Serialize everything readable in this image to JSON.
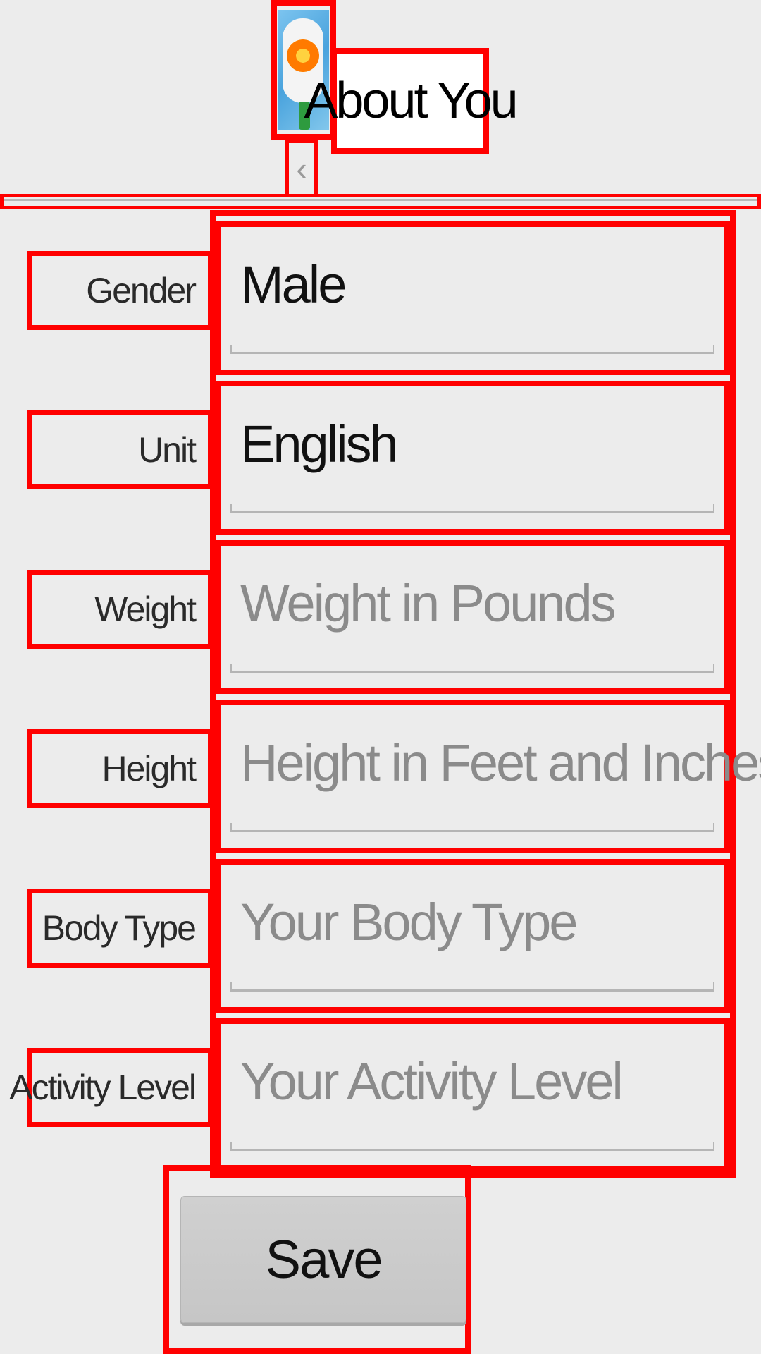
{
  "header": {
    "title": "About You",
    "app_icon": "app-logo-icon",
    "back_icon": "chevron-left-icon",
    "back_glyph": "‹"
  },
  "form": {
    "fields": [
      {
        "label": "Gender",
        "value": "Male",
        "placeholder": ""
      },
      {
        "label": "Unit",
        "value": "English",
        "placeholder": ""
      },
      {
        "label": "Weight",
        "value": "",
        "placeholder": "Weight in Pounds"
      },
      {
        "label": "Height",
        "value": "",
        "placeholder": "Height in Feet and Inches"
      },
      {
        "label": "Body Type",
        "value": "",
        "placeholder": "Your Body Type"
      },
      {
        "label": "Activity Level",
        "value": "",
        "placeholder": "Your Activity Level"
      }
    ]
  },
  "actions": {
    "save_label": "Save"
  },
  "colors": {
    "background": "#ececec",
    "highlight": "#ff0000",
    "placeholder_text": "#8b8b8b",
    "button": "#c8c8c8"
  }
}
